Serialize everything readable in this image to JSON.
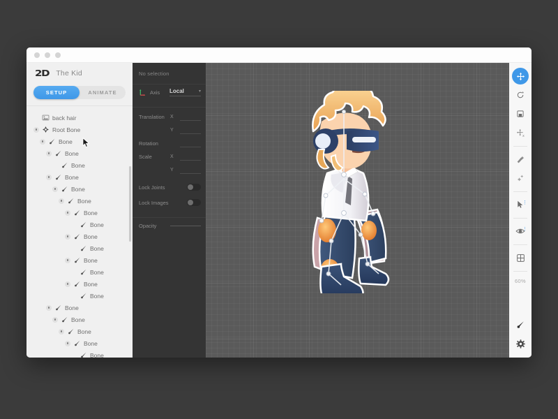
{
  "window": {
    "traffic_lights": [
      "close",
      "minimize",
      "maximize"
    ]
  },
  "sidebar": {
    "logo": "2D",
    "project_title": "The Kid",
    "tabs": [
      {
        "label": "SETUP",
        "active": true
      },
      {
        "label": "ANIMATE",
        "active": false
      }
    ],
    "tree": [
      {
        "label": "back hair",
        "depth": 0,
        "icon": "image-icon",
        "has_toggle": false
      },
      {
        "label": "Root Bone",
        "depth": 0,
        "icon": "root-bone-icon",
        "has_toggle": true
      },
      {
        "label": "Bone",
        "depth": 1,
        "icon": "bone-icon",
        "has_toggle": true
      },
      {
        "label": "Bone",
        "depth": 2,
        "icon": "bone-icon",
        "has_toggle": true
      },
      {
        "label": "Bone",
        "depth": 3,
        "icon": "bone-icon",
        "has_toggle": false
      },
      {
        "label": "Bone",
        "depth": 2,
        "icon": "bone-icon",
        "has_toggle": true
      },
      {
        "label": "Bone",
        "depth": 3,
        "icon": "bone-icon",
        "has_toggle": true
      },
      {
        "label": "Bone",
        "depth": 4,
        "icon": "bone-icon",
        "has_toggle": true
      },
      {
        "label": "Bone",
        "depth": 5,
        "icon": "bone-icon",
        "has_toggle": true
      },
      {
        "label": "Bone",
        "depth": 6,
        "icon": "bone-icon",
        "has_toggle": false
      },
      {
        "label": "Bone",
        "depth": 5,
        "icon": "bone-icon",
        "has_toggle": true
      },
      {
        "label": "Bone",
        "depth": 6,
        "icon": "bone-icon",
        "has_toggle": false
      },
      {
        "label": "Bone",
        "depth": 5,
        "icon": "bone-icon",
        "has_toggle": true
      },
      {
        "label": "Bone",
        "depth": 6,
        "icon": "bone-icon",
        "has_toggle": false
      },
      {
        "label": "Bone",
        "depth": 5,
        "icon": "bone-icon",
        "has_toggle": true
      },
      {
        "label": "Bone",
        "depth": 6,
        "icon": "bone-icon",
        "has_toggle": false
      },
      {
        "label": "Bone",
        "depth": 2,
        "icon": "bone-icon",
        "has_toggle": true
      },
      {
        "label": "Bone",
        "depth": 3,
        "icon": "bone-icon",
        "has_toggle": true
      },
      {
        "label": "Bone",
        "depth": 4,
        "icon": "bone-icon",
        "has_toggle": true
      },
      {
        "label": "Bone",
        "depth": 5,
        "icon": "bone-icon",
        "has_toggle": true
      },
      {
        "label": "Bone",
        "depth": 6,
        "icon": "bone-icon",
        "has_toggle": false
      }
    ]
  },
  "properties": {
    "selection_status": "No selection",
    "axis_label": "Axis",
    "axis_value": "Local",
    "axis_caret": "▾",
    "translation_label": "Translation",
    "translation_x_label": "X",
    "translation_y_label": "Y",
    "translation_x_value": "",
    "translation_y_value": "",
    "rotation_label": "Rotation",
    "rotation_value": "",
    "scale_label": "Scale",
    "scale_x_label": "X",
    "scale_y_label": "Y",
    "scale_x_value": "",
    "scale_y_value": "",
    "lock_joints_label": "Lock Joints",
    "lock_joints_on": false,
    "lock_images_label": "Lock Images",
    "lock_images_on": false,
    "opacity_label": "Opacity"
  },
  "canvas": {
    "background_color": "#5a5a5a",
    "grid_enabled": true,
    "artwork_name": "the-kid-character",
    "artwork_description": "Cartoon boy with blonde spiky hair wearing a dark blue VR visor, white shirt, navy pants with orange knee pads and navy boots, overlaid with a white bone rig"
  },
  "toolbar": {
    "tools": [
      {
        "name": "move-tool",
        "icon": "move-icon",
        "active": true
      },
      {
        "name": "rotate-tool",
        "icon": "rotate-icon",
        "active": false
      },
      {
        "name": "scale-tool",
        "icon": "scale-icon",
        "active": false
      },
      {
        "name": "transform-tool",
        "icon": "transform-icon",
        "active": false
      },
      {
        "name": "magic-wand-tool",
        "icon": "magic-wand-icon",
        "active": false
      },
      {
        "name": "sparkle-tool",
        "icon": "sparkle-icon",
        "active": false
      },
      {
        "name": "select-tool",
        "icon": "cursor-icon",
        "active": false
      },
      {
        "name": "visibility-tool",
        "icon": "eye-icon",
        "active": false
      },
      {
        "name": "grid-tool",
        "icon": "grid-icon",
        "active": false
      }
    ],
    "zoom_level": "60%",
    "bottom_tools": [
      {
        "name": "bone-tool",
        "icon": "bone-icon",
        "active": false
      },
      {
        "name": "settings-tool",
        "icon": "gear-icon",
        "active": false
      }
    ]
  },
  "colors": {
    "accent": "#3f98e8",
    "sidebar_bg": "#f0f0f0",
    "panel_bg": "#343434",
    "canvas_bg": "#5a5a5a",
    "desktop_bg": "#3b3b3b"
  }
}
